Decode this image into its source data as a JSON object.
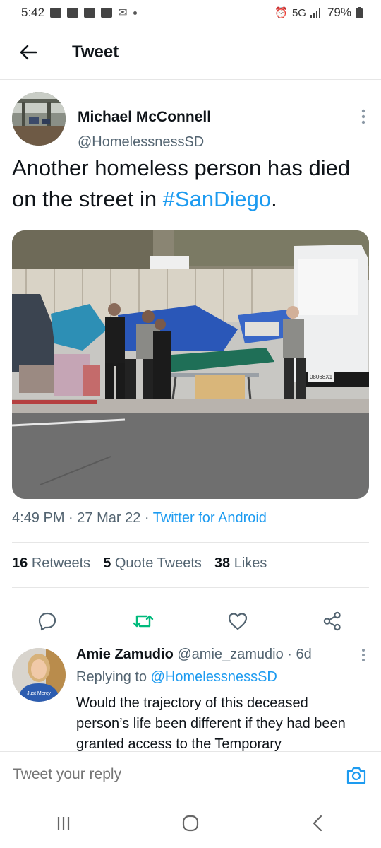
{
  "status_bar": {
    "time": "5:42",
    "network": "5G",
    "battery": "79%"
  },
  "header": {
    "title": "Tweet"
  },
  "tweet": {
    "author_name": "Michael McConnell",
    "author_handle": "@HomelessnessSD",
    "text_before": "Another homeless person has died on the street in ",
    "hashtag": "#SanDiego",
    "text_after": ".",
    "time": "4:49 PM",
    "date": "27 Mar 22",
    "source": "Twitter for Android",
    "sep": " · ",
    "retweets_count": "16",
    "retweets_label": "Retweets",
    "quotes_count": "5",
    "quotes_label": "Quote Tweets",
    "likes_count": "38",
    "likes_label": "Likes",
    "media_label": "08068X1",
    "colors": {
      "accent": "#1d9bf0",
      "retweet": "#00ba7c"
    }
  },
  "reply": {
    "name": "Amie Zamudio",
    "handle": "@amie_zamudio",
    "age": "6d",
    "replying_prefix": "Replying to ",
    "replying_handle": "@HomelessnessSD",
    "text": "Would the trajectory of this deceased person’s life been different if they had been granted access to the Temporary",
    "avatar_text": "Just Mercy"
  },
  "compose": {
    "placeholder": "Tweet your reply"
  },
  "icons": [
    "back-arrow-icon",
    "more-icon",
    "reply-icon",
    "retweet-icon",
    "like-icon",
    "share-icon",
    "camera-icon",
    "recents-icon",
    "home-icon",
    "back-icon"
  ]
}
